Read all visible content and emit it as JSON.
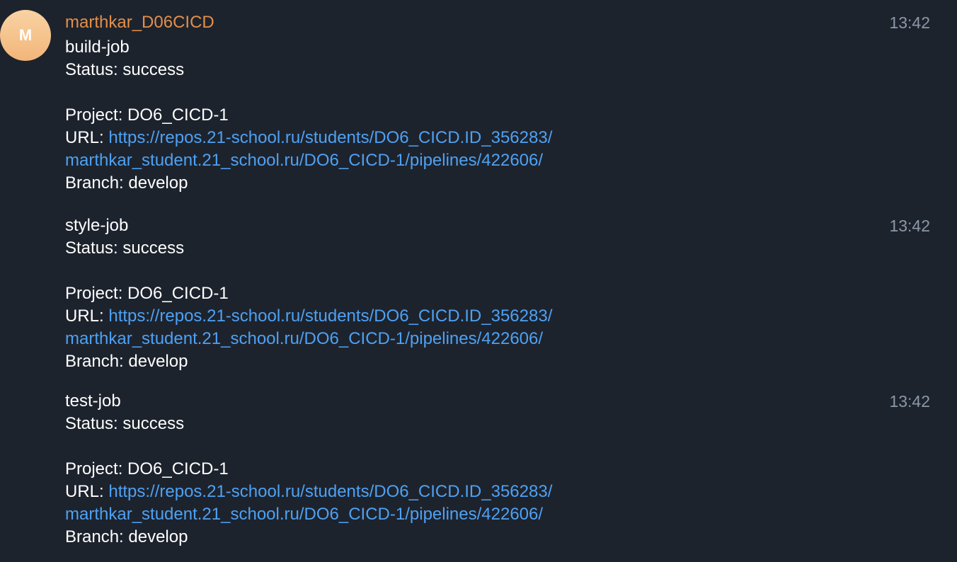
{
  "sender": {
    "avatar_letter": "M",
    "name": "marthkar_D06CICD",
    "name_color": "#e28f4a",
    "avatar_color": "#f2b57a"
  },
  "colors": {
    "background": "#1d232d",
    "link": "#4ea1f3",
    "timestamp": "#8b98a8"
  },
  "messages": [
    {
      "job": "build-job",
      "status": "Status: success",
      "project": "Project: DO6_CICD-1",
      "url_label": "URL: ",
      "url_line1": "https://repos.21-school.ru/students/DO6_CICD.ID_356283/",
      "url_line2": "marthkar_student.21_school.ru/DO6_CICD-1/pipelines/422606/",
      "branch": "Branch: develop",
      "time": "13:42"
    },
    {
      "job": "style-job",
      "status": "Status: success",
      "project": "Project: DO6_CICD-1",
      "url_label": "URL: ",
      "url_line1": "https://repos.21-school.ru/students/DO6_CICD.ID_356283/",
      "url_line2": "marthkar_student.21_school.ru/DO6_CICD-1/pipelines/422606/",
      "branch": "Branch: develop",
      "time": "13:42"
    },
    {
      "job": "test-job",
      "status": "Status: success",
      "project": "Project: DO6_CICD-1",
      "url_label": "URL: ",
      "url_line1": "https://repos.21-school.ru/students/DO6_CICD.ID_356283/",
      "url_line2": "marthkar_student.21_school.ru/DO6_CICD-1/pipelines/422606/",
      "branch": "Branch: develop",
      "time": "13:42"
    }
  ]
}
